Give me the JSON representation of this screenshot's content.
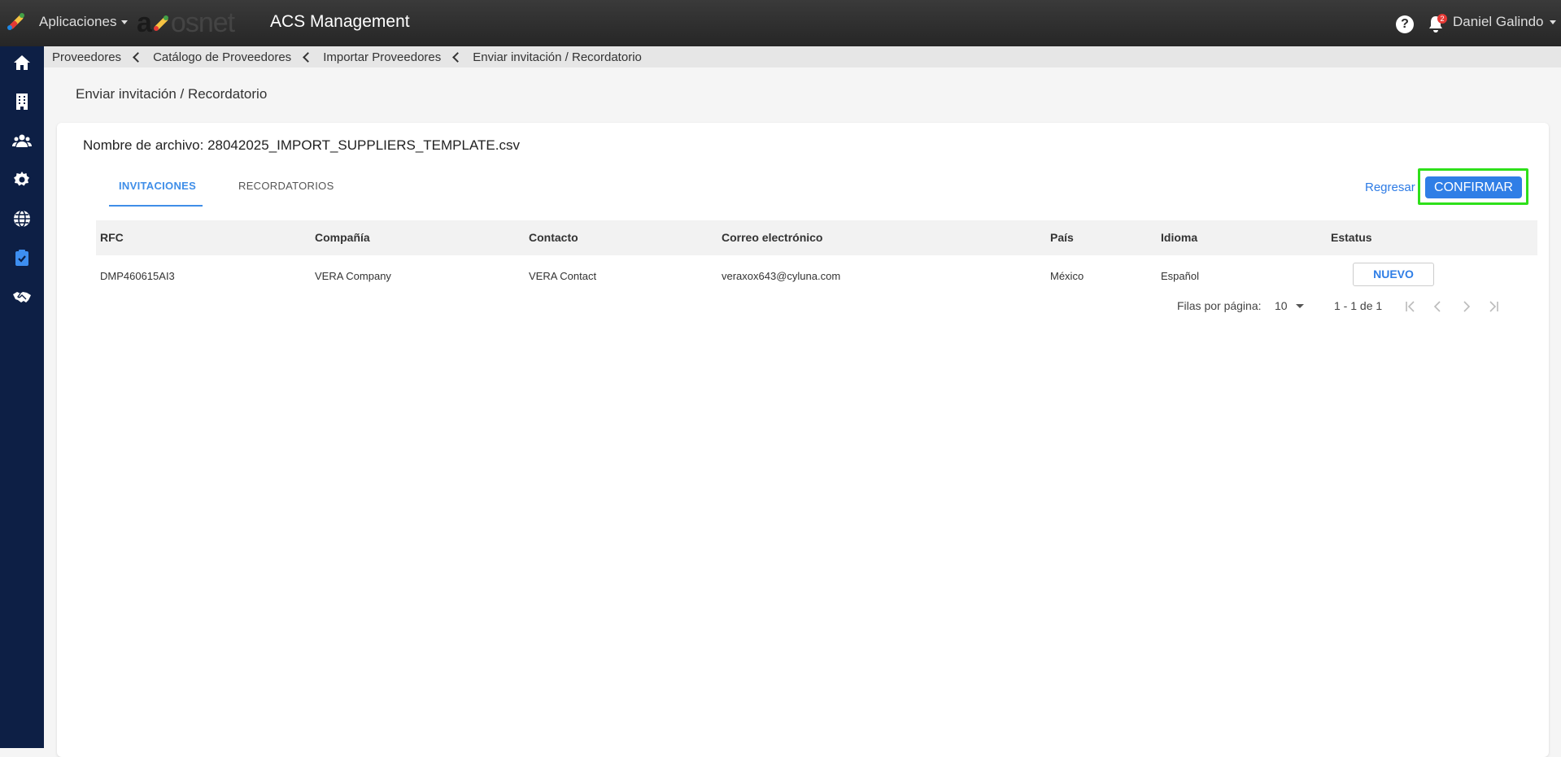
{
  "header": {
    "apps_label": "Aplicaciones",
    "brand_prefix": "a",
    "brand_suffix": "osnet",
    "app_title": "ACS Management",
    "help_symbol": "?",
    "notification_count": "2",
    "user_name": "Daniel Galindo"
  },
  "sidebar": {
    "items": [
      {
        "icon": "home-icon"
      },
      {
        "icon": "building-icon"
      },
      {
        "icon": "users-icon"
      },
      {
        "icon": "gear-icon"
      },
      {
        "icon": "globe-icon"
      },
      {
        "icon": "clipboard-check-icon",
        "active": true
      },
      {
        "icon": "handshake-icon"
      }
    ]
  },
  "breadcrumb": {
    "items": [
      "Proveedores",
      "Catálogo de Proveedores",
      "Importar Proveedores",
      "Enviar invitación / Recordatorio"
    ]
  },
  "page": {
    "title": "Enviar invitación / Recordatorio",
    "file_name": "Nombre de archivo: 28042025_IMPORT_SUPPLIERS_TEMPLATE.csv"
  },
  "tabs": {
    "invitations": "INVITACIONES",
    "reminders": "RECORDATORIOS",
    "active": "invitations"
  },
  "actions": {
    "back_label": "Regresar",
    "confirm_label": "CONFIRMAR"
  },
  "table": {
    "headers": {
      "rfc": "RFC",
      "company": "Compañía",
      "contact": "Contacto",
      "email": "Correo electrónico",
      "country": "País",
      "language": "Idioma",
      "status": "Estatus"
    },
    "rows": [
      {
        "rfc": "DMP460615AI3",
        "company": "VERA Company",
        "contact": "VERA Contact",
        "email": "veraxox643@cyluna.com",
        "country": "México",
        "language": "Español",
        "status": "NUEVO"
      }
    ]
  },
  "pagination": {
    "rows_per_page_label": "Filas por página:",
    "rows_per_page_value": "10",
    "range": "1 - 1 de 1"
  },
  "colors": {
    "accent": "#2f7ee6",
    "sidebar": "#0d1f45",
    "highlight": "#2ee01a"
  }
}
